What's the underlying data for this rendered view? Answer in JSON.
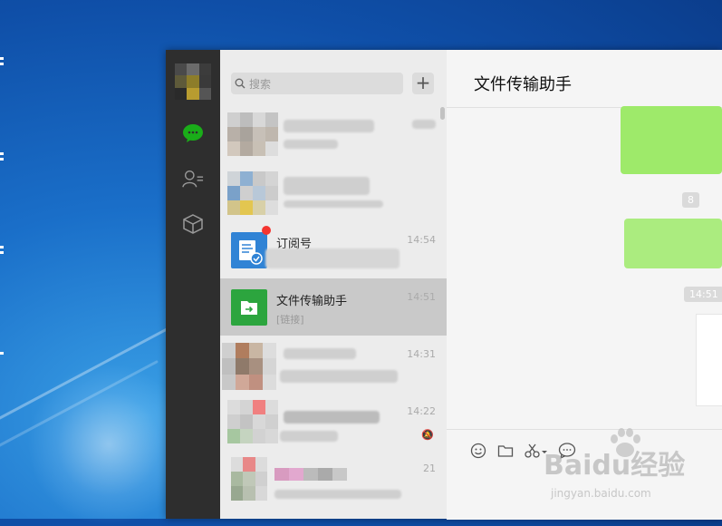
{
  "search": {
    "placeholder": "搜索"
  },
  "add_button": {
    "label": "+"
  },
  "conversations": [
    {
      "name": "",
      "time": "",
      "preview": ""
    },
    {
      "name": "",
      "time": "",
      "preview": ""
    },
    {
      "name": "订阅号",
      "time": "14:54",
      "preview": ""
    },
    {
      "name": "文件传输助手",
      "time": "14:51",
      "preview": "[链接]",
      "selected": true
    },
    {
      "name": "",
      "time": "14:31",
      "preview": ""
    },
    {
      "name": "",
      "time": "14:22",
      "preview": ""
    },
    {
      "name": "",
      "time": "21",
      "preview": ""
    }
  ],
  "chat": {
    "title": "文件传输助手",
    "timestamps": [
      "8",
      "14:51"
    ]
  },
  "watermark": {
    "brand": "Baidu经验",
    "url": "jingyan.baidu.com"
  },
  "colors": {
    "accent": "#1aad19",
    "bubble": "#9eea6a",
    "nav_bg": "#2e2e2e"
  }
}
